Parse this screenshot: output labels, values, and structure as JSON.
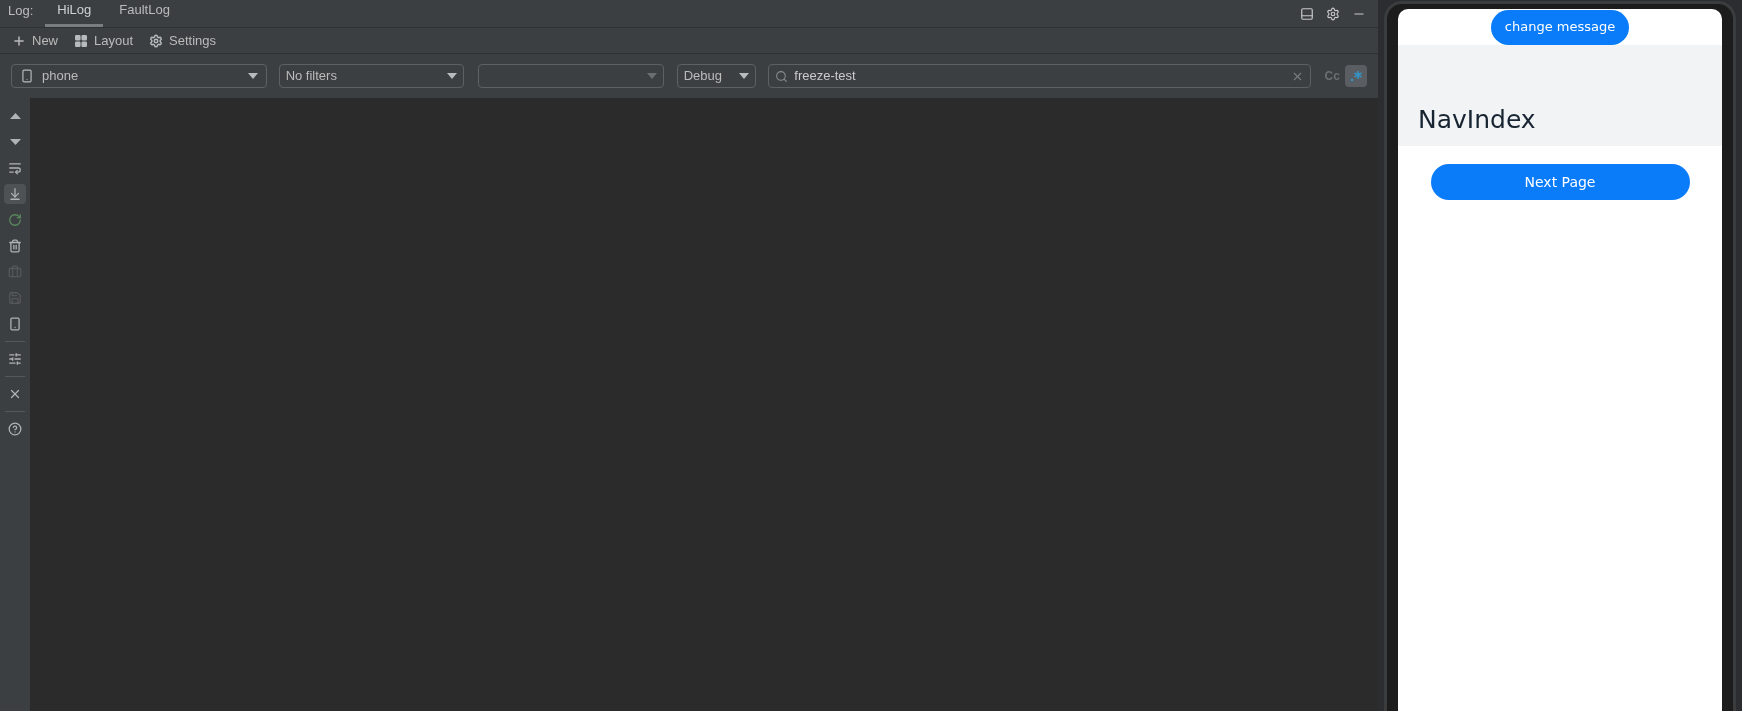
{
  "log_tabs": {
    "label": "Log:",
    "tabs": [
      {
        "label": "HiLog",
        "selected": true
      },
      {
        "label": "FaultLog",
        "selected": false
      }
    ]
  },
  "toolbar": [
    {
      "kind": "new",
      "label": "New"
    },
    {
      "kind": "layout",
      "label": "Layout"
    },
    {
      "kind": "settings",
      "label": "Settings"
    }
  ],
  "filters": {
    "device": {
      "value": "phone"
    },
    "filter": {
      "value": "No filters"
    },
    "level": {
      "value": "Debug"
    },
    "search": {
      "value": "freeze-test"
    },
    "match_case": {
      "label": "Cc",
      "on": false
    },
    "regex": {
      "on": true
    }
  },
  "sidebar_tools": [
    {
      "kind": "up",
      "selected": false,
      "disabled": false
    },
    {
      "kind": "down",
      "selected": false,
      "disabled": false
    },
    {
      "kind": "wrap",
      "selected": false,
      "disabled": false
    },
    {
      "kind": "scroll-end",
      "selected": true,
      "disabled": false
    },
    {
      "kind": "restart",
      "selected": false,
      "disabled": false
    },
    {
      "kind": "clear",
      "selected": false,
      "disabled": false
    },
    {
      "kind": "case",
      "selected": false,
      "disabled": true
    },
    {
      "kind": "save",
      "selected": false,
      "disabled": true
    },
    {
      "kind": "device",
      "selected": false,
      "disabled": false
    },
    {
      "kind": "sep"
    },
    {
      "kind": "sliders",
      "selected": false,
      "disabled": false
    },
    {
      "kind": "sep"
    },
    {
      "kind": "close",
      "selected": false,
      "disabled": false
    },
    {
      "kind": "sep"
    },
    {
      "kind": "help",
      "selected": false,
      "disabled": false
    }
  ],
  "phone": {
    "top_button": "change message",
    "title": "NavIndex",
    "main_button": "Next Page"
  }
}
